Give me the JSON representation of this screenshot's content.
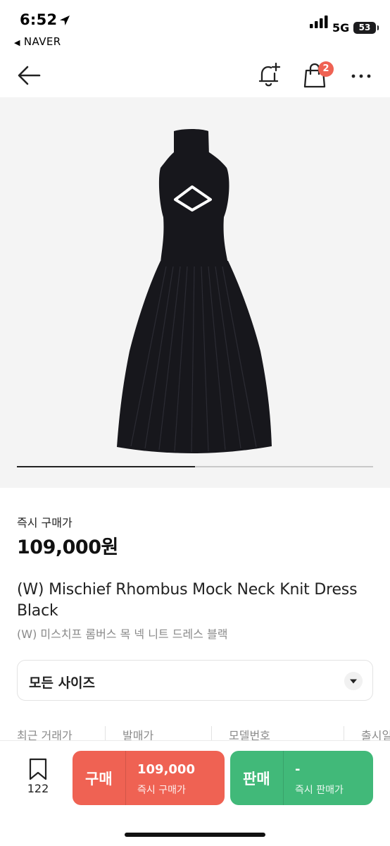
{
  "status_bar": {
    "time": "6:52",
    "back_app": "NAVER",
    "network": "5G",
    "battery": "53"
  },
  "header": {
    "cart_badge": "2",
    "icons": [
      "back-arrow-icon",
      "bell-plus-icon",
      "shopping-bag-icon",
      "more-icon"
    ]
  },
  "product": {
    "image_progress": 0.5,
    "price_label": "즉시 구매가",
    "price": "109,000원",
    "title_en": "(W) Mischief Rhombus Mock Neck Knit Dress Black",
    "title_ko": "(W) 미스치프 롬버스 목 넥 니트 드레스 블랙"
  },
  "size_select": {
    "label": "모든 사이즈"
  },
  "info_row": [
    "최근 거래가",
    "발매가",
    "모델번호",
    "출시일"
  ],
  "bottom_bar": {
    "wish_count": "122",
    "buy": {
      "label": "구매",
      "price": "109,000",
      "sub": "즉시 구매가"
    },
    "sell": {
      "label": "판매",
      "price": "-",
      "sub": "즉시 판매가"
    }
  },
  "colors": {
    "buy": "#ef6253",
    "sell": "#41b979",
    "badge": "#ef6253",
    "image_bg": "#f4f4f4"
  }
}
